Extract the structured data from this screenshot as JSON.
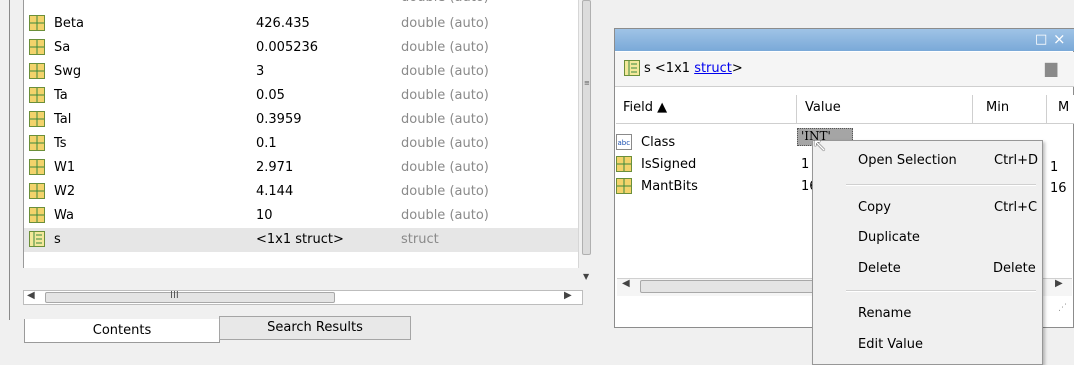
{
  "workspace": {
    "rows": [
      {
        "name": "Beta",
        "value": "426.435",
        "class": "double (auto)",
        "icon": "matrix-icon"
      },
      {
        "name": "Sa",
        "value": "0.005236",
        "class": "double (auto)",
        "icon": "matrix-icon"
      },
      {
        "name": "Swg",
        "value": "3",
        "class": "double (auto)",
        "icon": "matrix-icon"
      },
      {
        "name": "Ta",
        "value": "0.05",
        "class": "double (auto)",
        "icon": "matrix-icon"
      },
      {
        "name": "Tal",
        "value": "0.3959",
        "class": "double (auto)",
        "icon": "matrix-icon"
      },
      {
        "name": "Ts",
        "value": "0.1",
        "class": "double (auto)",
        "icon": "matrix-icon"
      },
      {
        "name": "W1",
        "value": "2.971",
        "class": "double (auto)",
        "icon": "matrix-icon"
      },
      {
        "name": "W2",
        "value": "4.144",
        "class": "double (auto)",
        "icon": "matrix-icon"
      },
      {
        "name": "Wa",
        "value": "10",
        "class": "double (auto)",
        "icon": "matrix-icon"
      },
      {
        "name": "s",
        "value": "<1x1 struct>",
        "class": "struct",
        "icon": "struct-icon"
      }
    ],
    "tabs": [
      "Contents",
      "Search Results"
    ]
  },
  "variable_editor": {
    "path_prefix": "s <1x1",
    "path_link": "struct",
    "path_suffix": ">",
    "columns": [
      "Field ▲",
      "Value",
      "Min",
      "M"
    ],
    "fields": [
      {
        "name": "Class",
        "icon": "text-abc-icon"
      },
      {
        "name": "IsSigned",
        "icon": "matrix-icon"
      },
      {
        "name": "MantBits",
        "icon": "matrix-icon"
      }
    ],
    "class_value": "'INT'",
    "issigned_value": "1",
    "mantbits_value": "16",
    "partial_values": [
      "1",
      "16"
    ]
  },
  "context_menu": {
    "items": [
      {
        "label": "Open Selection",
        "shortcut": "Ctrl+D"
      },
      {
        "label": "Copy",
        "shortcut": "Ctrl+C"
      },
      {
        "label": "Duplicate",
        "shortcut": ""
      },
      {
        "label": "Delete",
        "shortcut": "Delete"
      },
      {
        "label": "Rename",
        "shortcut": ""
      },
      {
        "label": "Edit Value",
        "shortcut": ""
      }
    ]
  },
  "colors": {
    "title_bar": "#7aa9d8",
    "link": "#0000ee",
    "matrix_icon_fill": "#f3d36b",
    "matrix_icon_line": "#3d8a3d"
  }
}
